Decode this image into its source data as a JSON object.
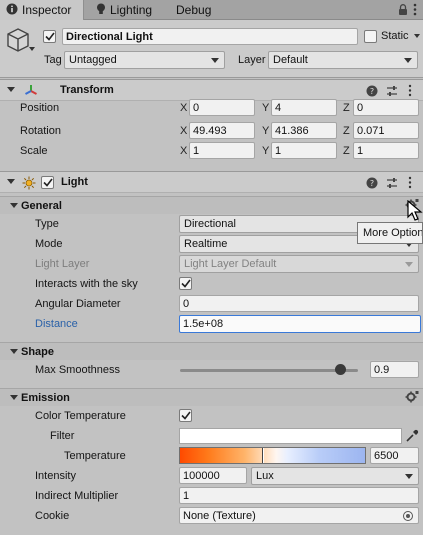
{
  "tabs": [
    {
      "label": "Inspector",
      "icon": "info-icon"
    },
    {
      "label": "Lighting",
      "icon": "lightbulb-icon"
    },
    {
      "label": "Debug"
    }
  ],
  "object": {
    "name": "Directional Light",
    "static_label": "Static",
    "tag_label": "Tag",
    "tag_value": "Untagged",
    "layer_label": "Layer",
    "layer_value": "Default"
  },
  "transform": {
    "title": "Transform",
    "rows": [
      {
        "label": "Position",
        "x": "0",
        "y": "4",
        "z": "0"
      },
      {
        "label": "Rotation",
        "x": "49.493",
        "y": "41.386",
        "z": "0.071"
      },
      {
        "label": "Scale",
        "x": "1",
        "y": "1",
        "z": "1"
      }
    ],
    "axes": [
      "X",
      "Y",
      "Z"
    ]
  },
  "light": {
    "title": "Light",
    "general": {
      "title": "General",
      "type_label": "Type",
      "type_value": "Directional",
      "mode_label": "Mode",
      "mode_value": "Realtime",
      "light_layer_label": "Light Layer",
      "light_layer_value": "Light Layer Default",
      "sky_label": "Interacts with the sky",
      "angular_label": "Angular Diameter",
      "angular_value": "0",
      "distance_label": "Distance",
      "distance_value": "1.5e+08"
    },
    "shape": {
      "title": "Shape",
      "smoothness_label": "Max Smoothness",
      "smoothness_value": "0.9",
      "smoothness_fraction": 0.9
    },
    "emission": {
      "title": "Emission",
      "color_temp_label": "Color Temperature",
      "filter_label": "Filter",
      "filter_color": "#ffffff",
      "temperature_label": "Temperature",
      "temperature_value": "6500",
      "intensity_label": "Intensity",
      "intensity_value": "100000",
      "intensity_unit": "Lux",
      "indirect_label": "Indirect Multiplier",
      "indirect_value": "1",
      "cookie_label": "Cookie",
      "cookie_value": "None (Texture)"
    }
  },
  "tooltip": "More Options"
}
